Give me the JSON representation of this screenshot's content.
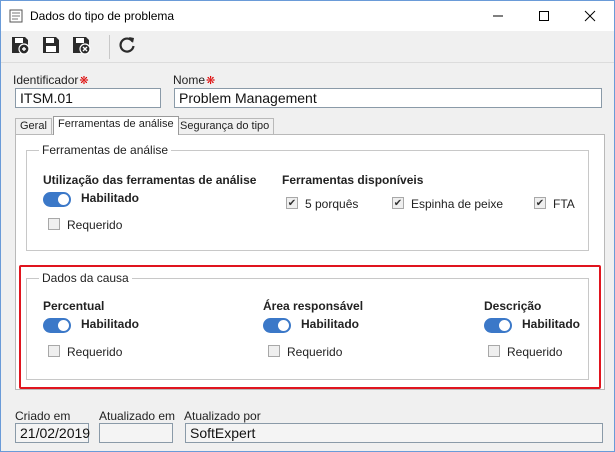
{
  "window": {
    "title": "Dados do tipo de problema"
  },
  "toolbar": {
    "save": "save-icon",
    "save_new": "save-and-new-icon",
    "save_close": "save-and-close-icon",
    "refresh": "refresh-icon"
  },
  "form": {
    "identifier_label": "Identificador",
    "identifier_value": "ITSM.01",
    "name_label": "Nome",
    "name_value": "Problem Management"
  },
  "tabs": [
    "Geral",
    "Ferramentas de análise",
    "Segurança do tipo"
  ],
  "analysis_tools": {
    "group_title": "Ferramentas de análise",
    "usage_label": "Utilização das ferramentas de análise",
    "usage_toggle": "Habilitado",
    "required_label": "Requerido",
    "available_label": "Ferramentas disponíveis",
    "tools": [
      "5 porquês",
      "Espinha de peixe",
      "FTA"
    ],
    "tools_checked": [
      true,
      true,
      true
    ],
    "required_checked": false
  },
  "cause_data": {
    "group_title": "Dados da causa",
    "columns": [
      {
        "title": "Percentual",
        "toggle": "Habilitado",
        "required": "Requerido"
      },
      {
        "title": "Área responsável",
        "toggle": "Habilitado",
        "required": "Requerido"
      },
      {
        "title": "Descrição",
        "toggle": "Habilitado",
        "required": "Requerido"
      }
    ],
    "highlight_color": "#e0141e"
  },
  "footer": {
    "created_label": "Criado em",
    "created_value": "21/02/2019",
    "updated_label": "Atualizado em",
    "updated_value": "",
    "updated_by_label": "Atualizado por",
    "updated_by_value": "SoftExpert"
  },
  "colors": {
    "accent": "#3b78c8",
    "required": "#d00000"
  }
}
